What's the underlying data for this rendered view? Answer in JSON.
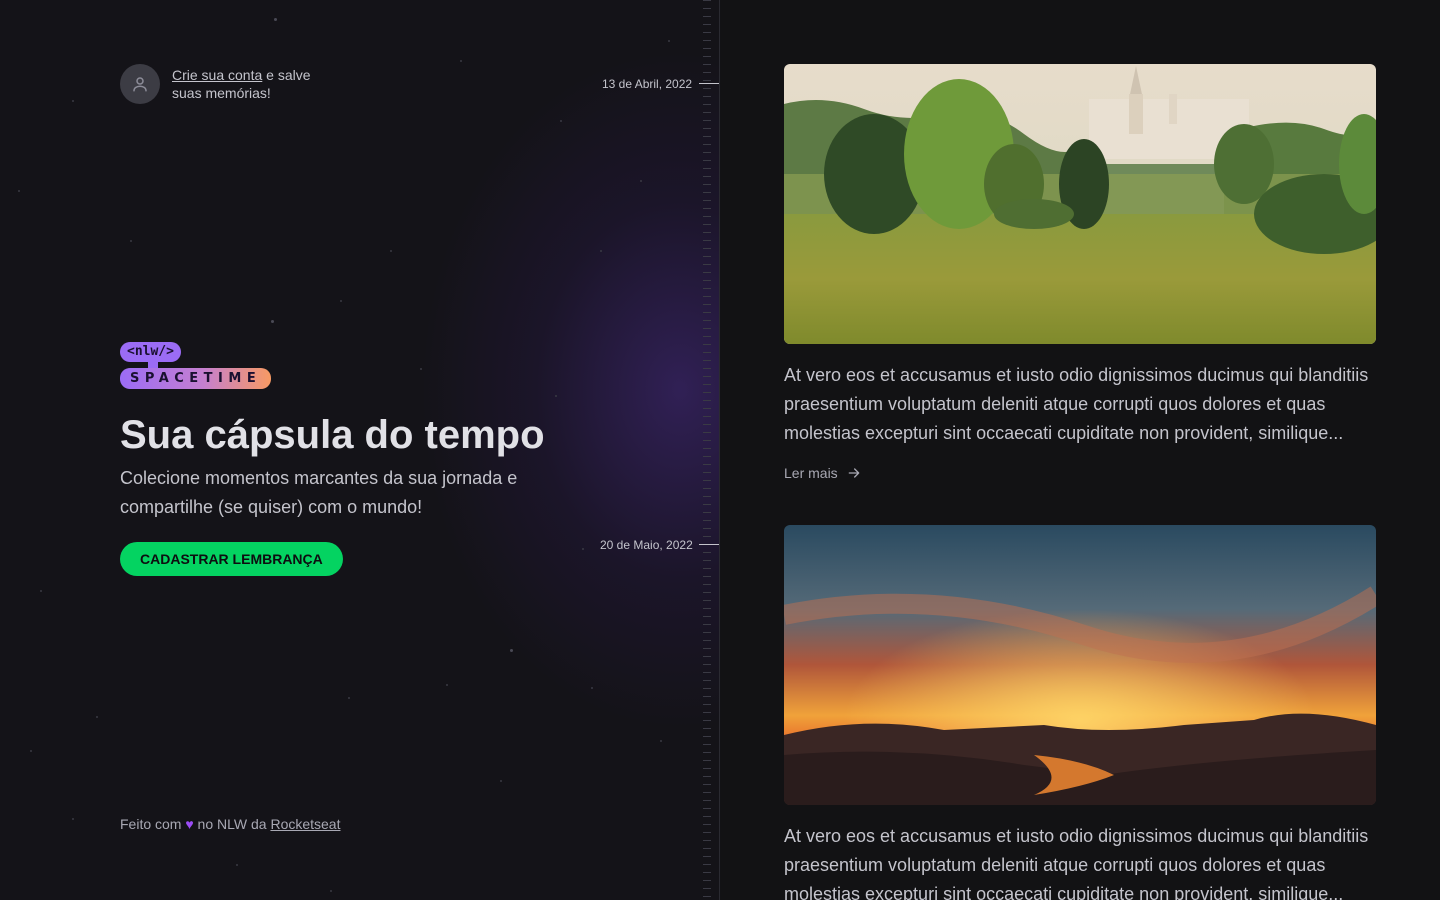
{
  "signin": {
    "link_text": "Crie sua conta",
    "rest_text": " e salve suas memórias!"
  },
  "logo": {
    "nlw": "<nlw/>",
    "spacetime": "SPACETIME"
  },
  "hero": {
    "title": "Sua cápsula do tempo",
    "subtitle": "Colecione momentos marcantes da sua jornada e compartilhe (se quiser) com o mundo!",
    "cta_label": "CADASTRAR LEMBRANÇA"
  },
  "footer": {
    "prefix": "Feito com",
    "middle": " no NLW da ",
    "link": "Rocketseat"
  },
  "memories": [
    {
      "date": "13 de Abril, 2022",
      "text": "At vero eos et accusamus et iusto odio dignissimos ducimus qui blanditiis praesentium voluptatum deleniti atque corrupti quos dolores et quas molestias excepturi sint occaecati cupiditate non provident, similique...",
      "read_more": "Ler mais"
    },
    {
      "date": "20 de Maio, 2022",
      "text": "At vero eos et accusamus et iusto odio dignissimos ducimus qui blanditiis praesentium voluptatum deleniti atque corrupti quos dolores et quas molestias excepturi sint occaecati cupiditate non provident, similique..."
    }
  ],
  "colors": {
    "accent_green": "#04d361",
    "accent_purple": "#9b6cf5",
    "accent_orange": "#f79a63",
    "background": "#121215"
  },
  "icons": {
    "avatar": "user-icon",
    "heart": "purple-heart-icon",
    "read_more": "arrow-right-icon"
  }
}
